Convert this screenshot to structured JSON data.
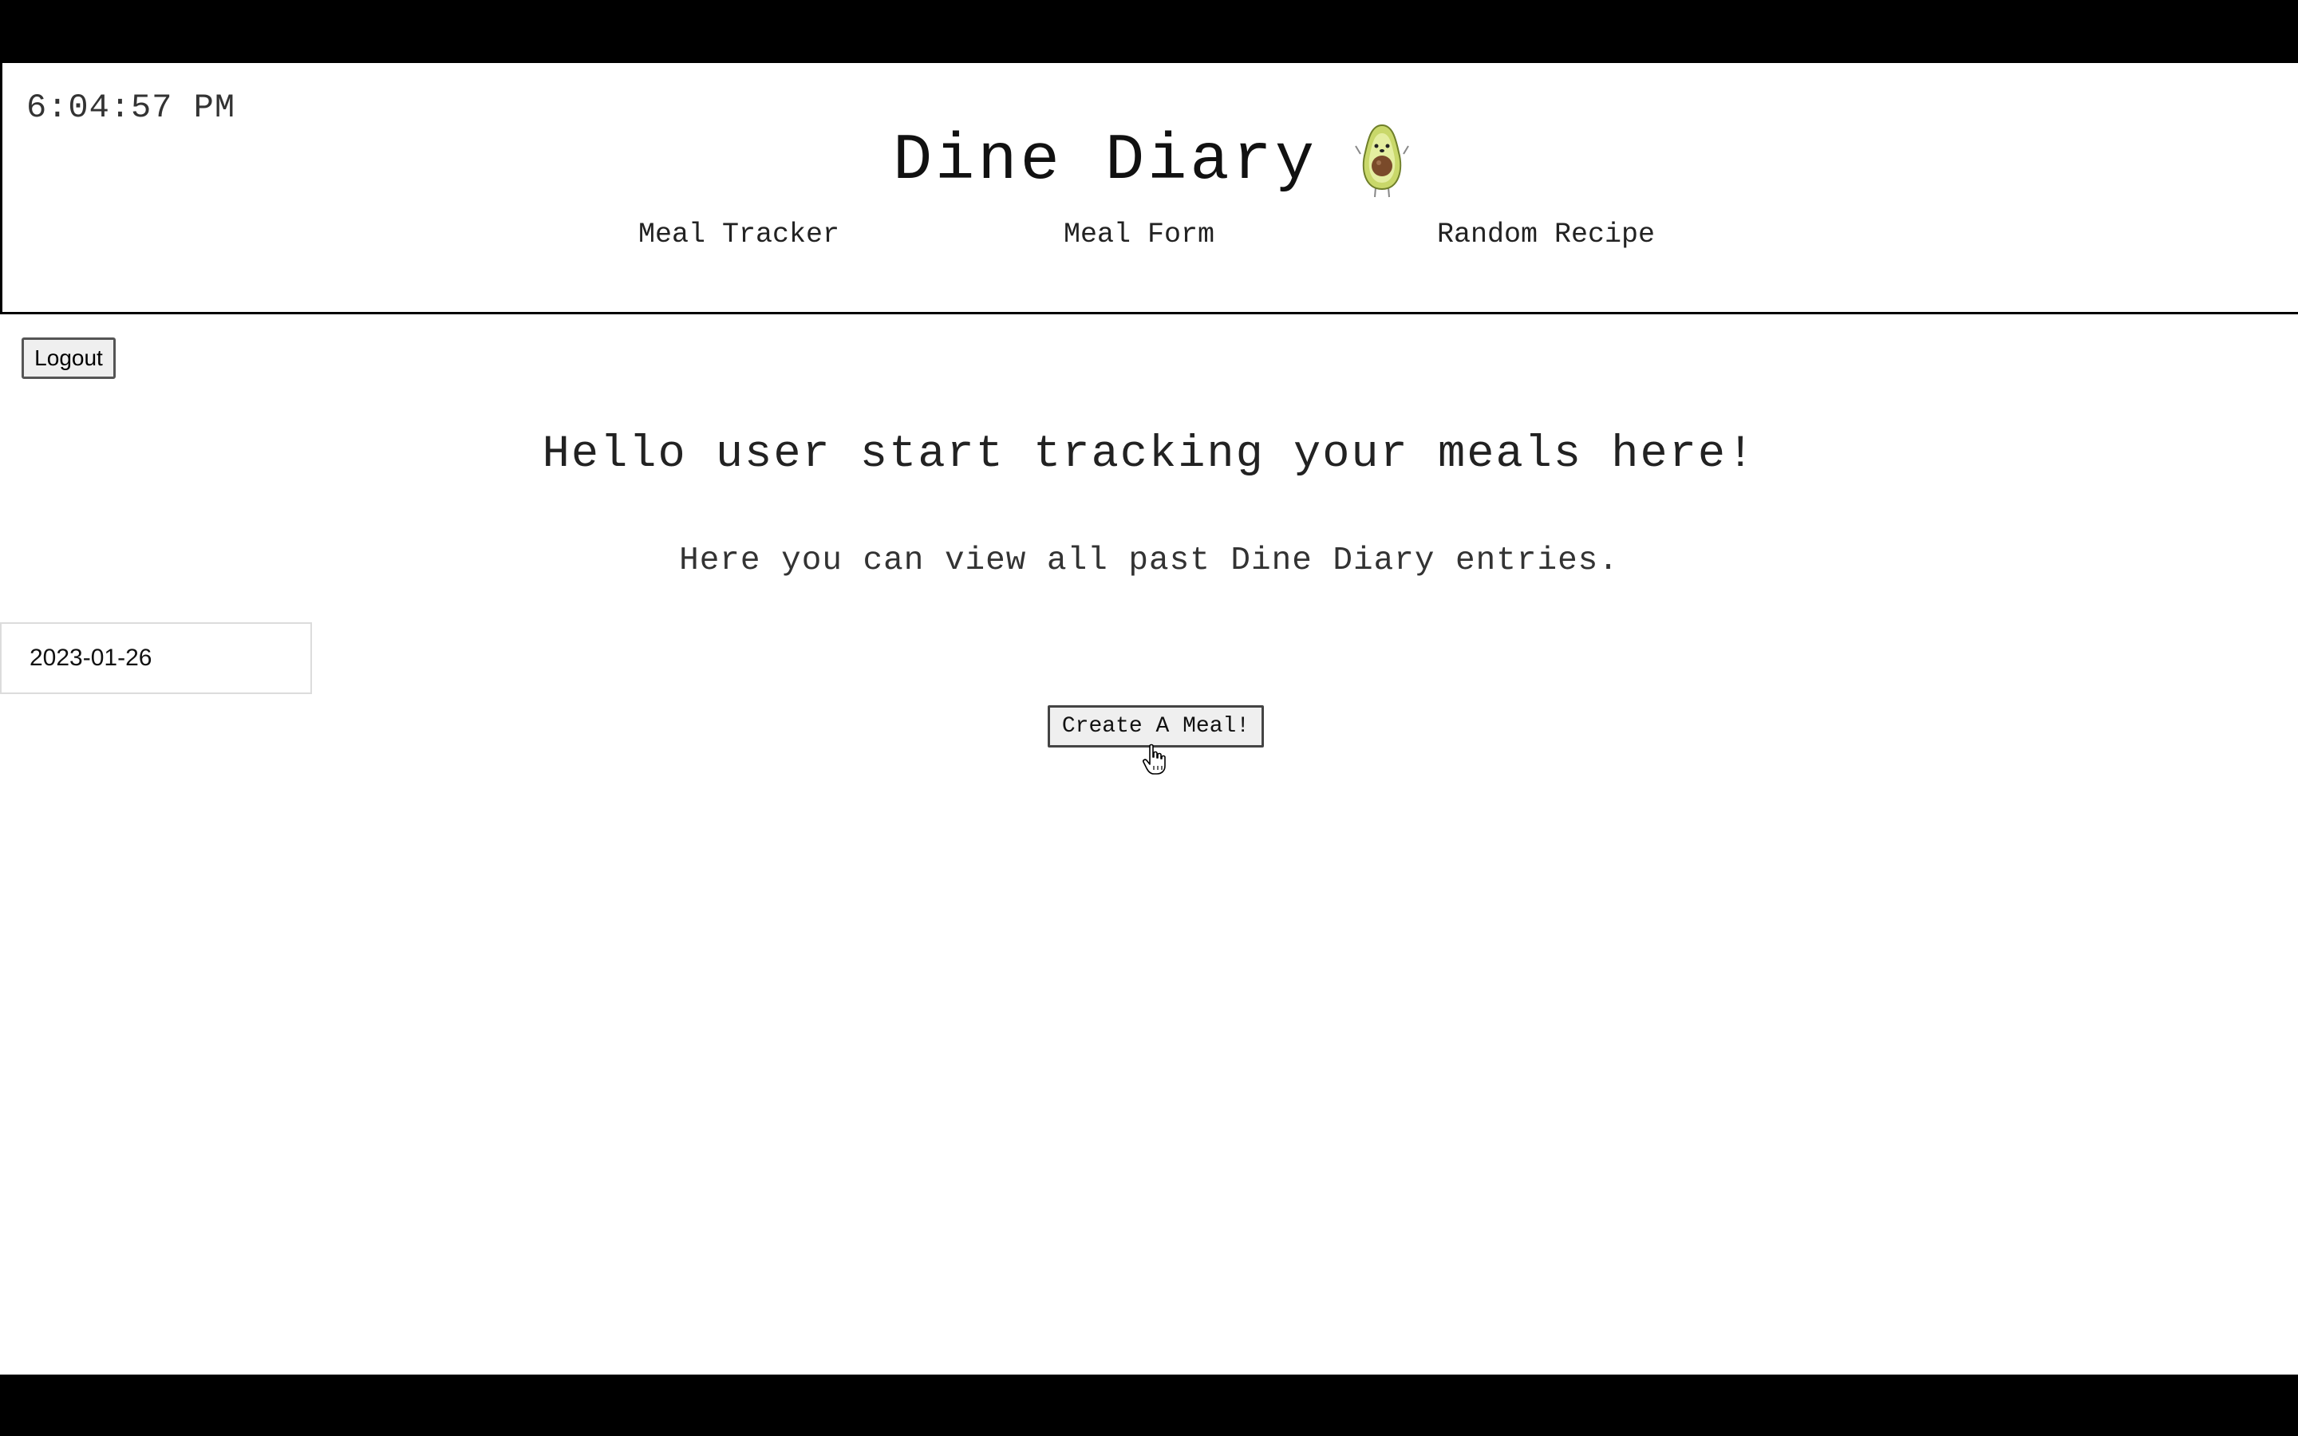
{
  "header": {
    "clock": "6:04:57 PM",
    "title": "Dine Diary",
    "logo_icon": "avocado-icon",
    "nav": [
      {
        "label": "Meal Tracker"
      },
      {
        "label": "Meal Form"
      },
      {
        "label": "Random Recipe"
      }
    ]
  },
  "actions": {
    "logout_label": "Logout",
    "create_label": "Create A Meal!"
  },
  "main": {
    "heading": "Hello user start tracking your meals here!",
    "subheading": "Here you can view all past Dine Diary entries.",
    "entries": [
      {
        "date": "2023-01-26"
      }
    ]
  },
  "colors": {
    "avocado_skin": "#c9d86a",
    "avocado_pit": "#7a4a2a",
    "button_bg": "#efefef"
  }
}
